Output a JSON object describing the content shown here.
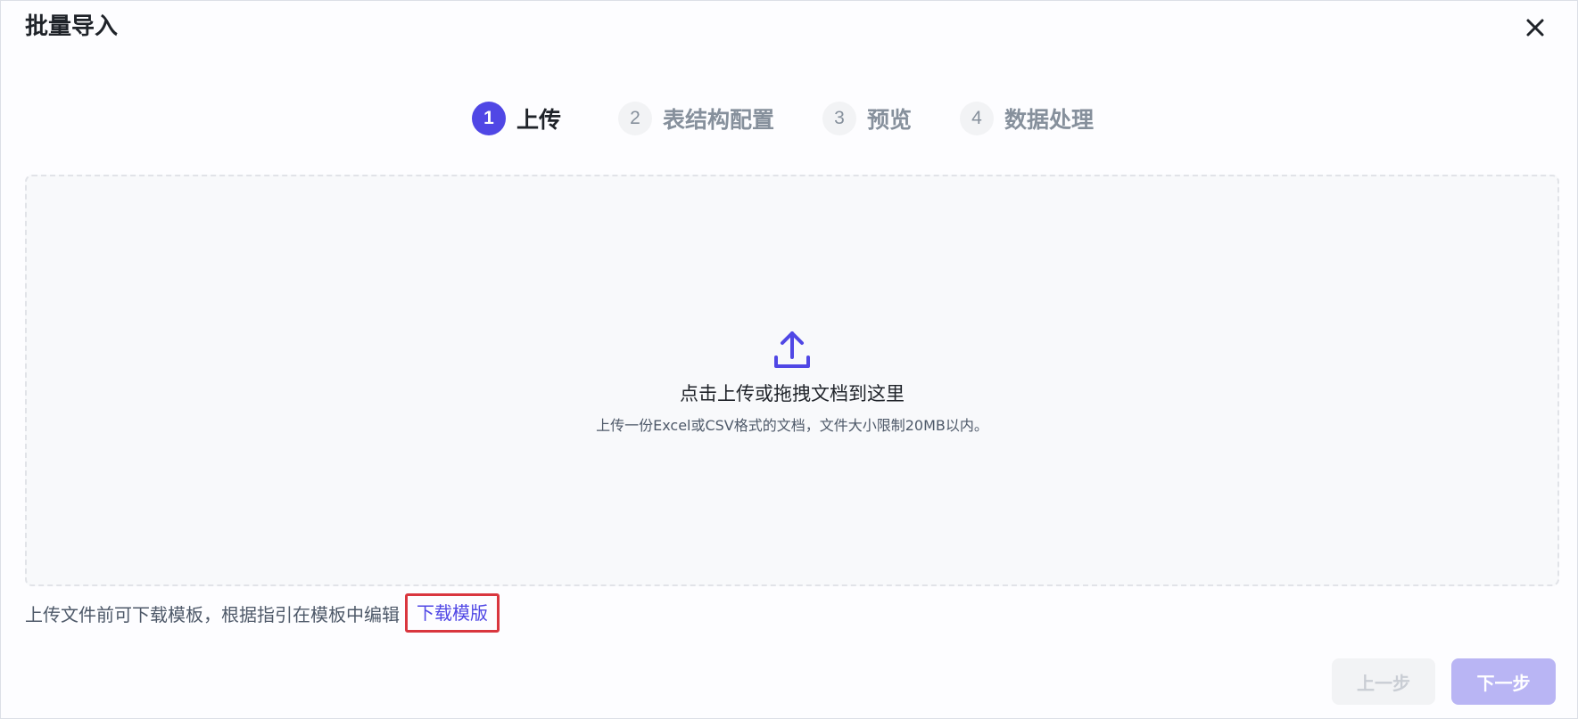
{
  "dialog": {
    "title": "批量导入"
  },
  "steps": [
    {
      "number": "1",
      "label": "上传",
      "active": true
    },
    {
      "number": "2",
      "label": "表结构配置",
      "active": false
    },
    {
      "number": "3",
      "label": "预览",
      "active": false
    },
    {
      "number": "4",
      "label": "数据处理",
      "active": false
    }
  ],
  "dropzone": {
    "icon": "upload-icon",
    "main_text": "点击上传或拖拽文档到这里",
    "sub_text": "上传一份Excel或CSV格式的文档，文件大小限制20MB以内。"
  },
  "hint": {
    "text": "上传文件前可下载模板，根据指引在模板中编辑",
    "link_label": "下载模版"
  },
  "footer": {
    "prev_label": "上一步",
    "next_label": "下一步"
  },
  "colors": {
    "accent": "#5047e5",
    "highlight_border": "#d9363e",
    "next_disabled": "#b9b5f4"
  }
}
